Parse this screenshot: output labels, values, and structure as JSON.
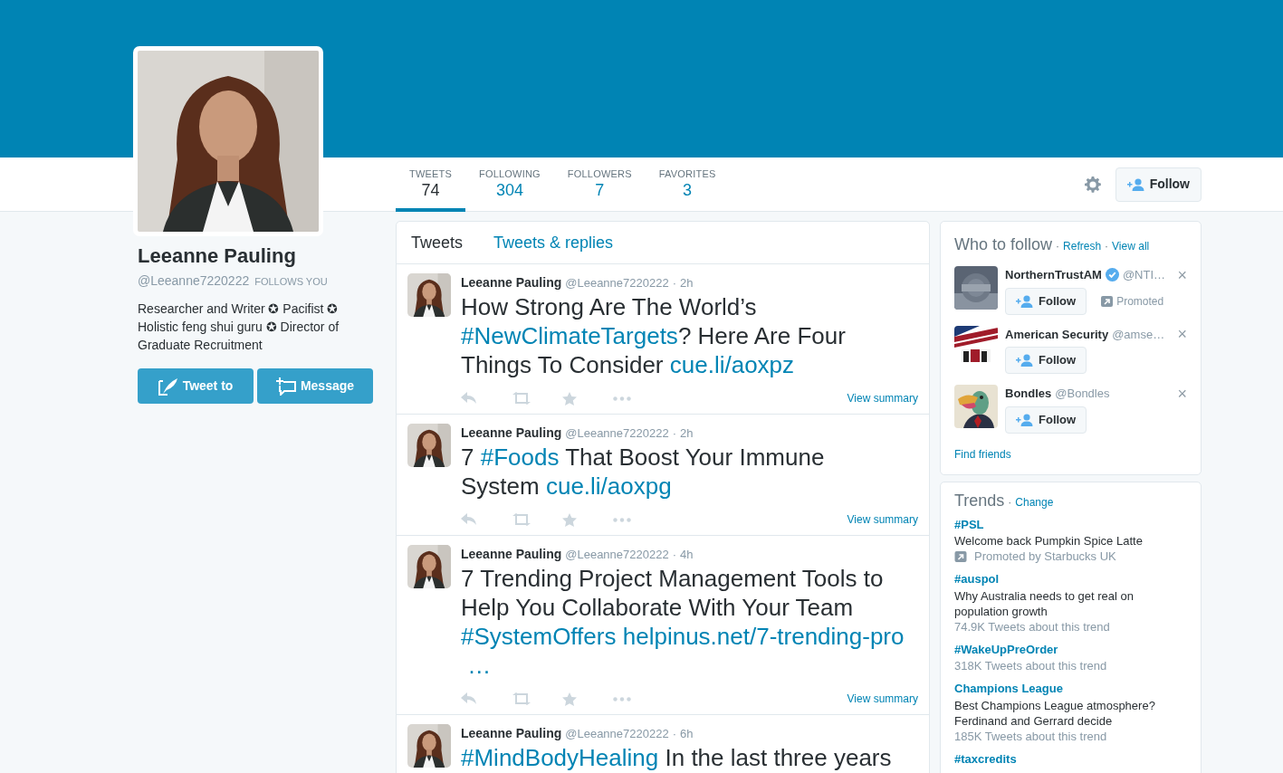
{
  "profile": {
    "name": "Leeanne Pauling",
    "handle": "@Leeanne7220222",
    "follows_you": "FOLLOWS YOU",
    "bio": "Researcher and Writer ✪ Pacifist ✪ Holistic feng shui guru ✪ Director of Graduate Recruitment",
    "buttons": [
      {
        "kind": "tweet",
        "label": "Tweet to"
      },
      {
        "kind": "message",
        "label": "Message"
      }
    ]
  },
  "stats": [
    {
      "label": "TWEETS",
      "value": "74",
      "selected": true
    },
    {
      "label": "FOLLOWING",
      "value": "304",
      "selected": false
    },
    {
      "label": "FOLLOWERS",
      "value": "7",
      "selected": false
    },
    {
      "label": "FAVORITES",
      "value": "3",
      "selected": false
    }
  ],
  "follow_button": "Follow",
  "timeline_tabs": [
    {
      "label": "Tweets",
      "selected": true
    },
    {
      "label": "Tweets & replies",
      "selected": false
    }
  ],
  "tweets": [
    {
      "name": "Leeanne Pauling",
      "handle": "@Leeanne7220222",
      "separator": "·",
      "time": "2h",
      "parts": [
        {
          "kind": "text",
          "text": "How Strong Are The World’s "
        },
        {
          "kind": "link",
          "text": "#NewClimateTargets"
        },
        {
          "kind": "text",
          "text": "? Here Are Four Things To Consider "
        },
        {
          "kind": "link",
          "text": "cue.li/aoxpz"
        }
      ],
      "summary": "View summary"
    },
    {
      "name": "Leeanne Pauling",
      "handle": "@Leeanne7220222",
      "separator": "·",
      "time": "2h",
      "parts": [
        {
          "kind": "text",
          "text": "7 "
        },
        {
          "kind": "link",
          "text": "#Foods"
        },
        {
          "kind": "text",
          "text": " That Boost Your Immune System "
        },
        {
          "kind": "link",
          "text": "cue.li/aoxpg"
        }
      ],
      "summary": "View summary"
    },
    {
      "name": "Leeanne Pauling",
      "handle": "@Leeanne7220222",
      "separator": "·",
      "time": "4h",
      "parts": [
        {
          "kind": "text",
          "text": "7 Trending Project Management Tools to Help You Collaborate With Your Team "
        },
        {
          "kind": "link",
          "text": "#SystemOffers"
        },
        {
          "kind": "link",
          "text": "helpinus.net/7-trending-pro"
        },
        {
          "kind": "link",
          "text": "…"
        }
      ],
      "summary": "View summary"
    },
    {
      "name": "Leeanne Pauling",
      "handle": "@Leeanne7220222",
      "separator": "·",
      "time": "6h",
      "parts": [
        {
          "kind": "link",
          "text": "#MindBodyHealing"
        },
        {
          "kind": "text",
          "text": " In the last three years"
        }
      ]
    }
  ],
  "who_to_follow": {
    "title": "Who to follow",
    "separator": "·",
    "links": [
      "Refresh",
      "View all"
    ],
    "accounts": [
      {
        "name": "NorthernTrustAM",
        "verified": true,
        "handle": "@NTI…",
        "dismiss": "×",
        "button": "Follow",
        "promoted": "Promoted"
      },
      {
        "name": "American Security",
        "verified": false,
        "handle": "@amse…",
        "dismiss": "×",
        "button": "Follow"
      },
      {
        "name": "Bondles",
        "verified": false,
        "handle": "@Bondles",
        "dismiss": "×",
        "button": "Follow"
      }
    ],
    "footer": "Find friends"
  },
  "trends": {
    "title": "Trends",
    "separator": "·",
    "link": "Change",
    "items": [
      {
        "tag": "#PSL",
        "description": "Welcome back Pumpkin Spice Latte",
        "promoted": "Promoted by Starbucks UK"
      },
      {
        "tag": "#auspol",
        "description": "Why Australia needs to get real on population growth",
        "meta": "74.9K Tweets about this trend"
      },
      {
        "tag": "#WakeUpPreOrder",
        "meta": "318K Tweets about this trend"
      },
      {
        "tag": "Champions League",
        "description": "Best Champions League atmosphere? Ferdinand and Gerrard decide",
        "meta": "185K Tweets about this trend"
      },
      {
        "tag": "#taxcredits"
      }
    ]
  }
}
